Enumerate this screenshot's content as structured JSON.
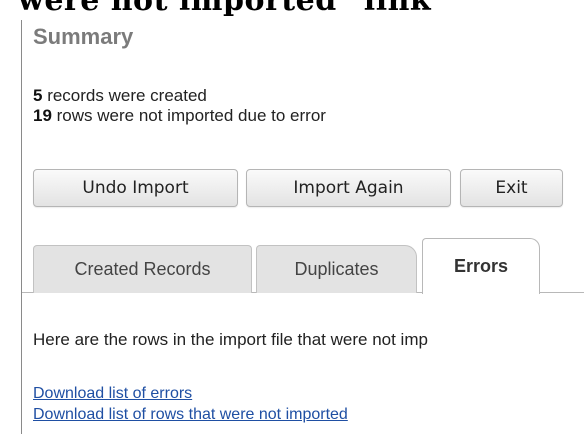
{
  "top_cut_text": "were not imported\" link",
  "summary": {
    "heading": "Summary",
    "created_count": "5",
    "created_text": " records were created",
    "error_count": "19",
    "error_text": " rows were not imported due to error"
  },
  "buttons": {
    "undo_import": "Undo Import",
    "import_again": "Import Again",
    "exit": "Exit"
  },
  "tabs": [
    {
      "label": "Created Records",
      "active": false
    },
    {
      "label": "Duplicates",
      "active": false
    },
    {
      "label": "Errors",
      "active": true
    }
  ],
  "errors_panel": {
    "intro": "Here are the rows in the import file that were not imp",
    "links": [
      "Download list of errors",
      "Download list of rows that were not imported"
    ]
  },
  "colors": {
    "heading": "#7b7b7b",
    "link": "#1f4fa3",
    "tab_inactive_bg": "#e3e3e3"
  }
}
